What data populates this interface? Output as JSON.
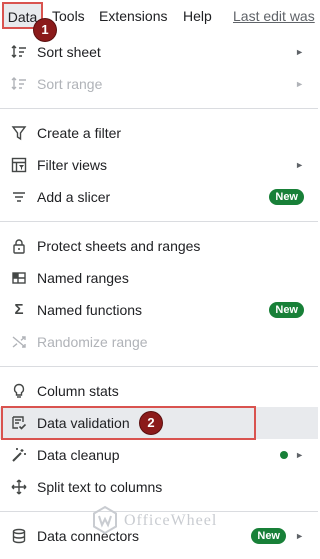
{
  "menubar": {
    "data": "Data",
    "tools": "Tools",
    "extensions": "Extensions",
    "help": "Help",
    "last_edit": "Last edit was"
  },
  "steps": {
    "one": "1",
    "two": "2"
  },
  "menu": {
    "sort_sheet": "Sort sheet",
    "sort_range": "Sort range",
    "create_filter": "Create a filter",
    "filter_views": "Filter views",
    "add_slicer": "Add a slicer",
    "protect": "Protect sheets and ranges",
    "named_ranges": "Named ranges",
    "named_functions": "Named functions",
    "randomize": "Randomize range",
    "column_stats": "Column stats",
    "data_validation": "Data validation",
    "data_cleanup": "Data cleanup",
    "split_text": "Split text to columns",
    "data_connectors": "Data connectors",
    "new_badge": "New",
    "arrow": "►"
  },
  "watermark": {
    "text": "OfficeWheel"
  },
  "colors": {
    "accent_red": "#d9534f",
    "badge_green": "#188038",
    "step_badge": "#8b1a1a"
  }
}
